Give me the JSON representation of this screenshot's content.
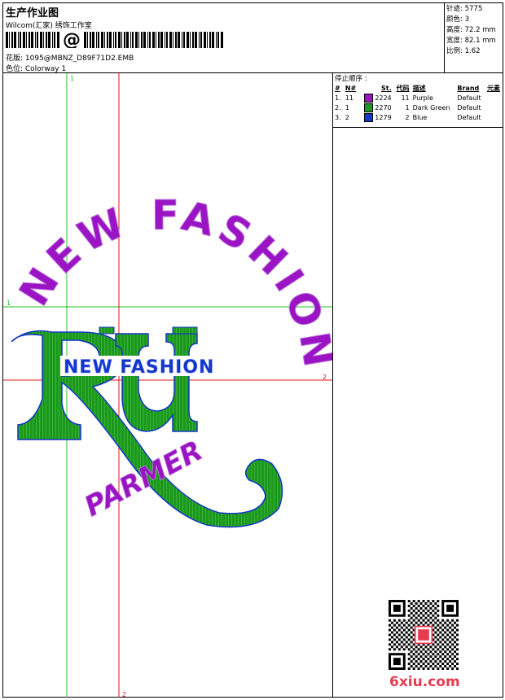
{
  "header": {
    "title": "生产作业图",
    "company": "Wilcom(汇家) 绣饰工作室",
    "barcode_symbol": "@",
    "pattern_file": "花版: 1095@MBNZ_D89F71D2.EMB",
    "colorway": "色位: Colorway 1"
  },
  "stats": [
    {
      "label": "针迹",
      "value": "5775"
    },
    {
      "label": "颜色",
      "value": "3"
    },
    {
      "label": "高度",
      "value": "72.2 mm"
    },
    {
      "label": "宽度",
      "value": "82.1 mm"
    },
    {
      "label": "比例",
      "value": "1.62"
    }
  ],
  "stop_sequence": {
    "heading": "停止顺序 :",
    "columns": [
      "#",
      "N#",
      "St.",
      "代码",
      "描述",
      "Brand",
      "元素"
    ],
    "rows": [
      {
        "idx": "1.",
        "n": "11",
        "color": "#9b14c3",
        "st": "2224",
        "code": "11",
        "desc": "Purple",
        "brand": "Default"
      },
      {
        "idx": "2.",
        "n": "1",
        "color": "#1a9a1a",
        "st": "2270",
        "code": "1",
        "desc": "Dark Green",
        "brand": "Default"
      },
      {
        "idx": "3.",
        "n": "2",
        "color": "#1436c8",
        "st": "1279",
        "code": "2",
        "desc": "Blue",
        "brand": "Default"
      }
    ]
  },
  "canvas": {
    "guide_labels": {
      "green_top": "1",
      "green_left": "1",
      "red_right": "2",
      "red_bottom": "2"
    },
    "arc_text": "NEW FASHION",
    "inner_text": "NEW FASHION",
    "bottom_text": "PARMER",
    "monogram": "RU"
  },
  "colors": {
    "purple": "#9b14c3",
    "green": "#1a9a1a",
    "blue": "#1436c8",
    "guide_green": "#22c422",
    "guide_red": "#e01a1a"
  },
  "watermark": "6xiu.com"
}
